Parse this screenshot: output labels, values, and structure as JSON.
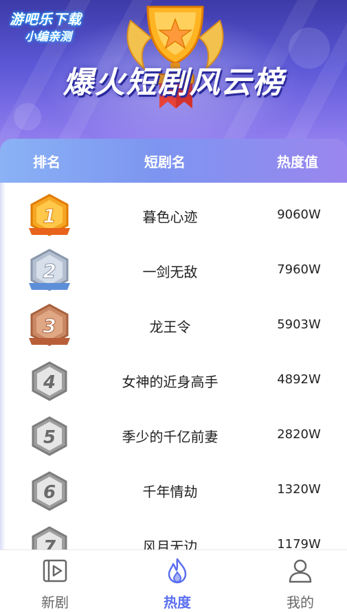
{
  "watermark": {
    "line1": "游吧乐下载",
    "line2": "小编亲测"
  },
  "banner": {
    "title": "爆火短剧风云榜"
  },
  "table": {
    "headers": {
      "rank": "排名",
      "name": "短剧名",
      "heat": "热度值"
    },
    "rows": [
      {
        "rank": "1",
        "name": "暮色心迹",
        "heat": "9060W",
        "medal": "gold"
      },
      {
        "rank": "2",
        "name": "一剑无敌",
        "heat": "7960W",
        "medal": "silver"
      },
      {
        "rank": "3",
        "name": "龙王令",
        "heat": "5903W",
        "medal": "bronze"
      },
      {
        "rank": "4",
        "name": "女神的近身高手",
        "heat": "4892W",
        "medal": "gray"
      },
      {
        "rank": "5",
        "name": "季少的千亿前妻",
        "heat": "2820W",
        "medal": "gray"
      },
      {
        "rank": "6",
        "name": "千年情劫",
        "heat": "1320W",
        "medal": "gray"
      },
      {
        "rank": "7",
        "name": "风月无边",
        "heat": "1179W",
        "medal": "gray"
      }
    ]
  },
  "nav": {
    "items": [
      {
        "label": "新剧",
        "icon": "play-video-icon",
        "active": false
      },
      {
        "label": "热度",
        "icon": "flame-icon",
        "active": true
      },
      {
        "label": "我的",
        "icon": "user-icon",
        "active": false
      }
    ]
  },
  "colors": {
    "accent": "#5a6ef0",
    "banner_top": "#3d3aa8",
    "banner_bottom": "#a99af2",
    "gold": "#f5a623",
    "silver": "#aab6c8",
    "bronze": "#c98863",
    "gray": "#a9a9a9"
  }
}
